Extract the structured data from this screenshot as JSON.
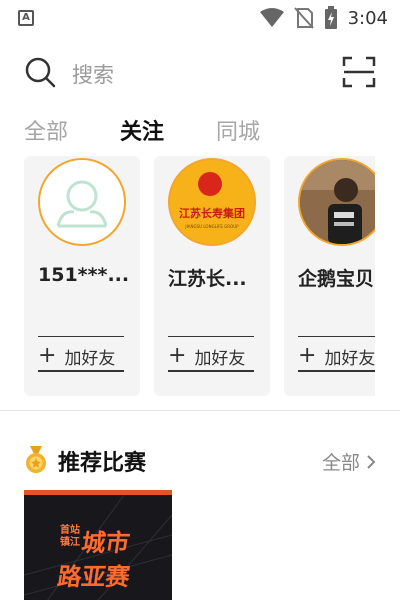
{
  "status_bar": {
    "time": "3:04",
    "notification_icon": "a-badge-icon",
    "icons": [
      "wifi-icon",
      "no-sim-icon",
      "battery-charging-icon"
    ]
  },
  "search": {
    "placeholder": "搜索",
    "search_icon": "search-icon",
    "scan_icon": "scan-icon"
  },
  "tabs": [
    {
      "label": "全部",
      "active": false
    },
    {
      "label": "关注",
      "active": true
    },
    {
      "label": "同城",
      "active": false
    }
  ],
  "recommend_users": [
    {
      "name": "151***...",
      "follow_label": "加好友",
      "avatar": "default-avatar"
    },
    {
      "name": "江苏长...",
      "follow_label": "加好友",
      "avatar": "jiangsu-changshou-logo"
    },
    {
      "name": "企鹅宝贝",
      "follow_label": "加好友",
      "avatar": "child-photo"
    }
  ],
  "section": {
    "title": "推荐比赛",
    "link_label": "全部",
    "icon": "medal-icon"
  },
  "match": {
    "title_line1": "城市",
    "title_line2": "路亚赛",
    "sub": "首站 镇江"
  },
  "colors": {
    "accent_orange": "#f3a62c",
    "match_red": "#ff6a2e",
    "tab_inactive": "#a6a6a6"
  }
}
